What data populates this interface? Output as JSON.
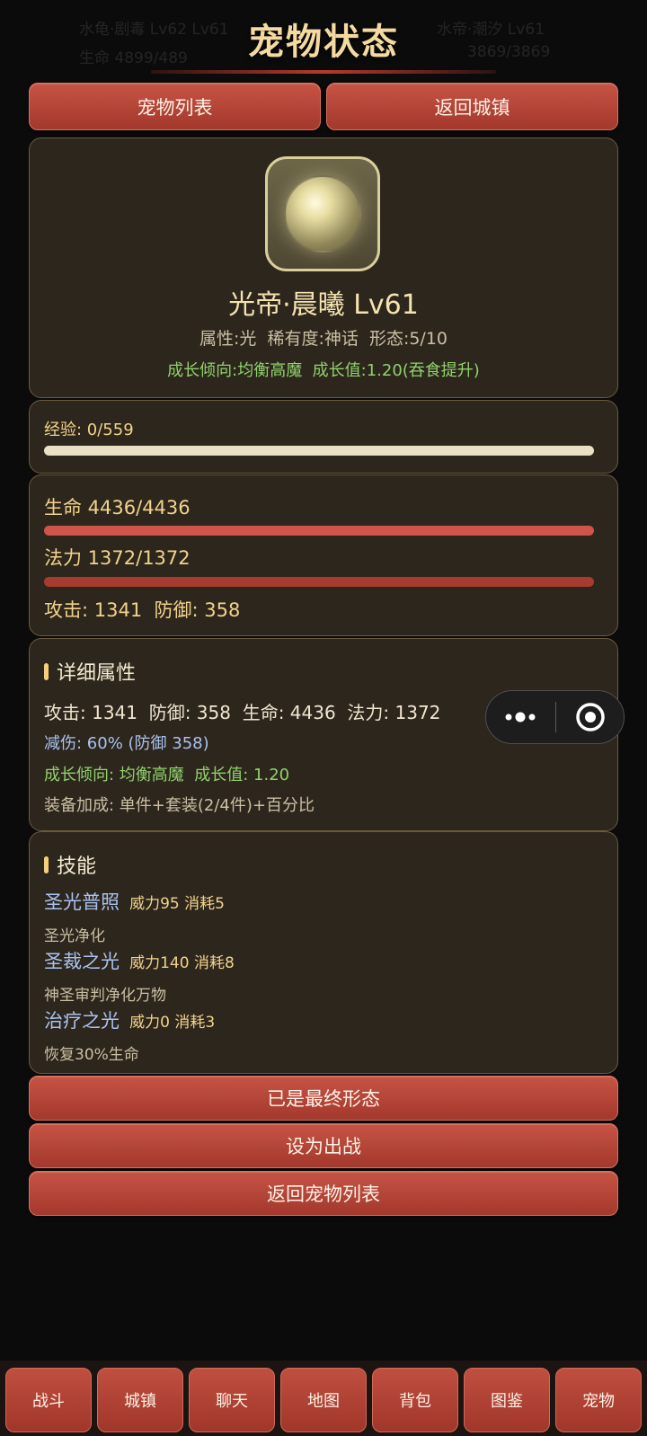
{
  "page_title": "宠物状态",
  "background_ghost": [
    "水龟·剧毒 Lv62 Lv61",
    "生命 4899/489",
    "水帝·潮汐 Lv61",
    "3869/3869"
  ],
  "top_buttons": {
    "pet_list": "宠物列表",
    "return_town": "返回城镇"
  },
  "pet": {
    "name": "光帝·晨曦 Lv61",
    "meta": "属性:光  稀有度:神话  形态:5/10",
    "growth": "成长倾向:均衡高魔  成长值:1.20(吞食提升)",
    "avatar_icon": "light-orb-icon"
  },
  "exp": {
    "label": "经验: 0/559",
    "fill": 1.0
  },
  "vitals": {
    "hp_label": "生命 4436/4436",
    "hp_fill": 1.0,
    "mp_label": "法力 1372/1372",
    "mp_fill": 1.0,
    "atk_def": "攻击: 1341  防御: 358"
  },
  "details": {
    "title": "详细属性",
    "stats": "攻击: 1341  防御: 358  生命: 4436  法力: 1372",
    "reduction": "减伤: 60% (防御 358)",
    "growth": "成长倾向: 均衡高魔  成长值: 1.20",
    "equip": "装备加成: 单件+套装(2/4件)+百分比"
  },
  "skills": {
    "title": "技能",
    "items": [
      {
        "name": "圣光普照",
        "stats": "威力95 消耗5",
        "desc": "圣光净化"
      },
      {
        "name": "圣裁之光",
        "stats": "威力140 消耗8",
        "desc": "神圣审判净化万物"
      },
      {
        "name": "治疗之光",
        "stats": "威力0 消耗3",
        "desc": "恢复30%生命"
      }
    ]
  },
  "actions": {
    "final_form": "已是最终形态",
    "set_battle": "设为出战",
    "back_list": "返回宠物列表"
  },
  "nav": [
    "战斗",
    "城镇",
    "聊天",
    "地图",
    "背包",
    "图鉴",
    "宠物"
  ],
  "colors": {
    "hp_bar": "#cf554b",
    "mp_bar": "#a83b2f",
    "exp_bar": "#e9e0c6",
    "growth_text": "#8fd16d",
    "skill_name": "#a9c3f0",
    "gold_text": "#f2d38c"
  }
}
